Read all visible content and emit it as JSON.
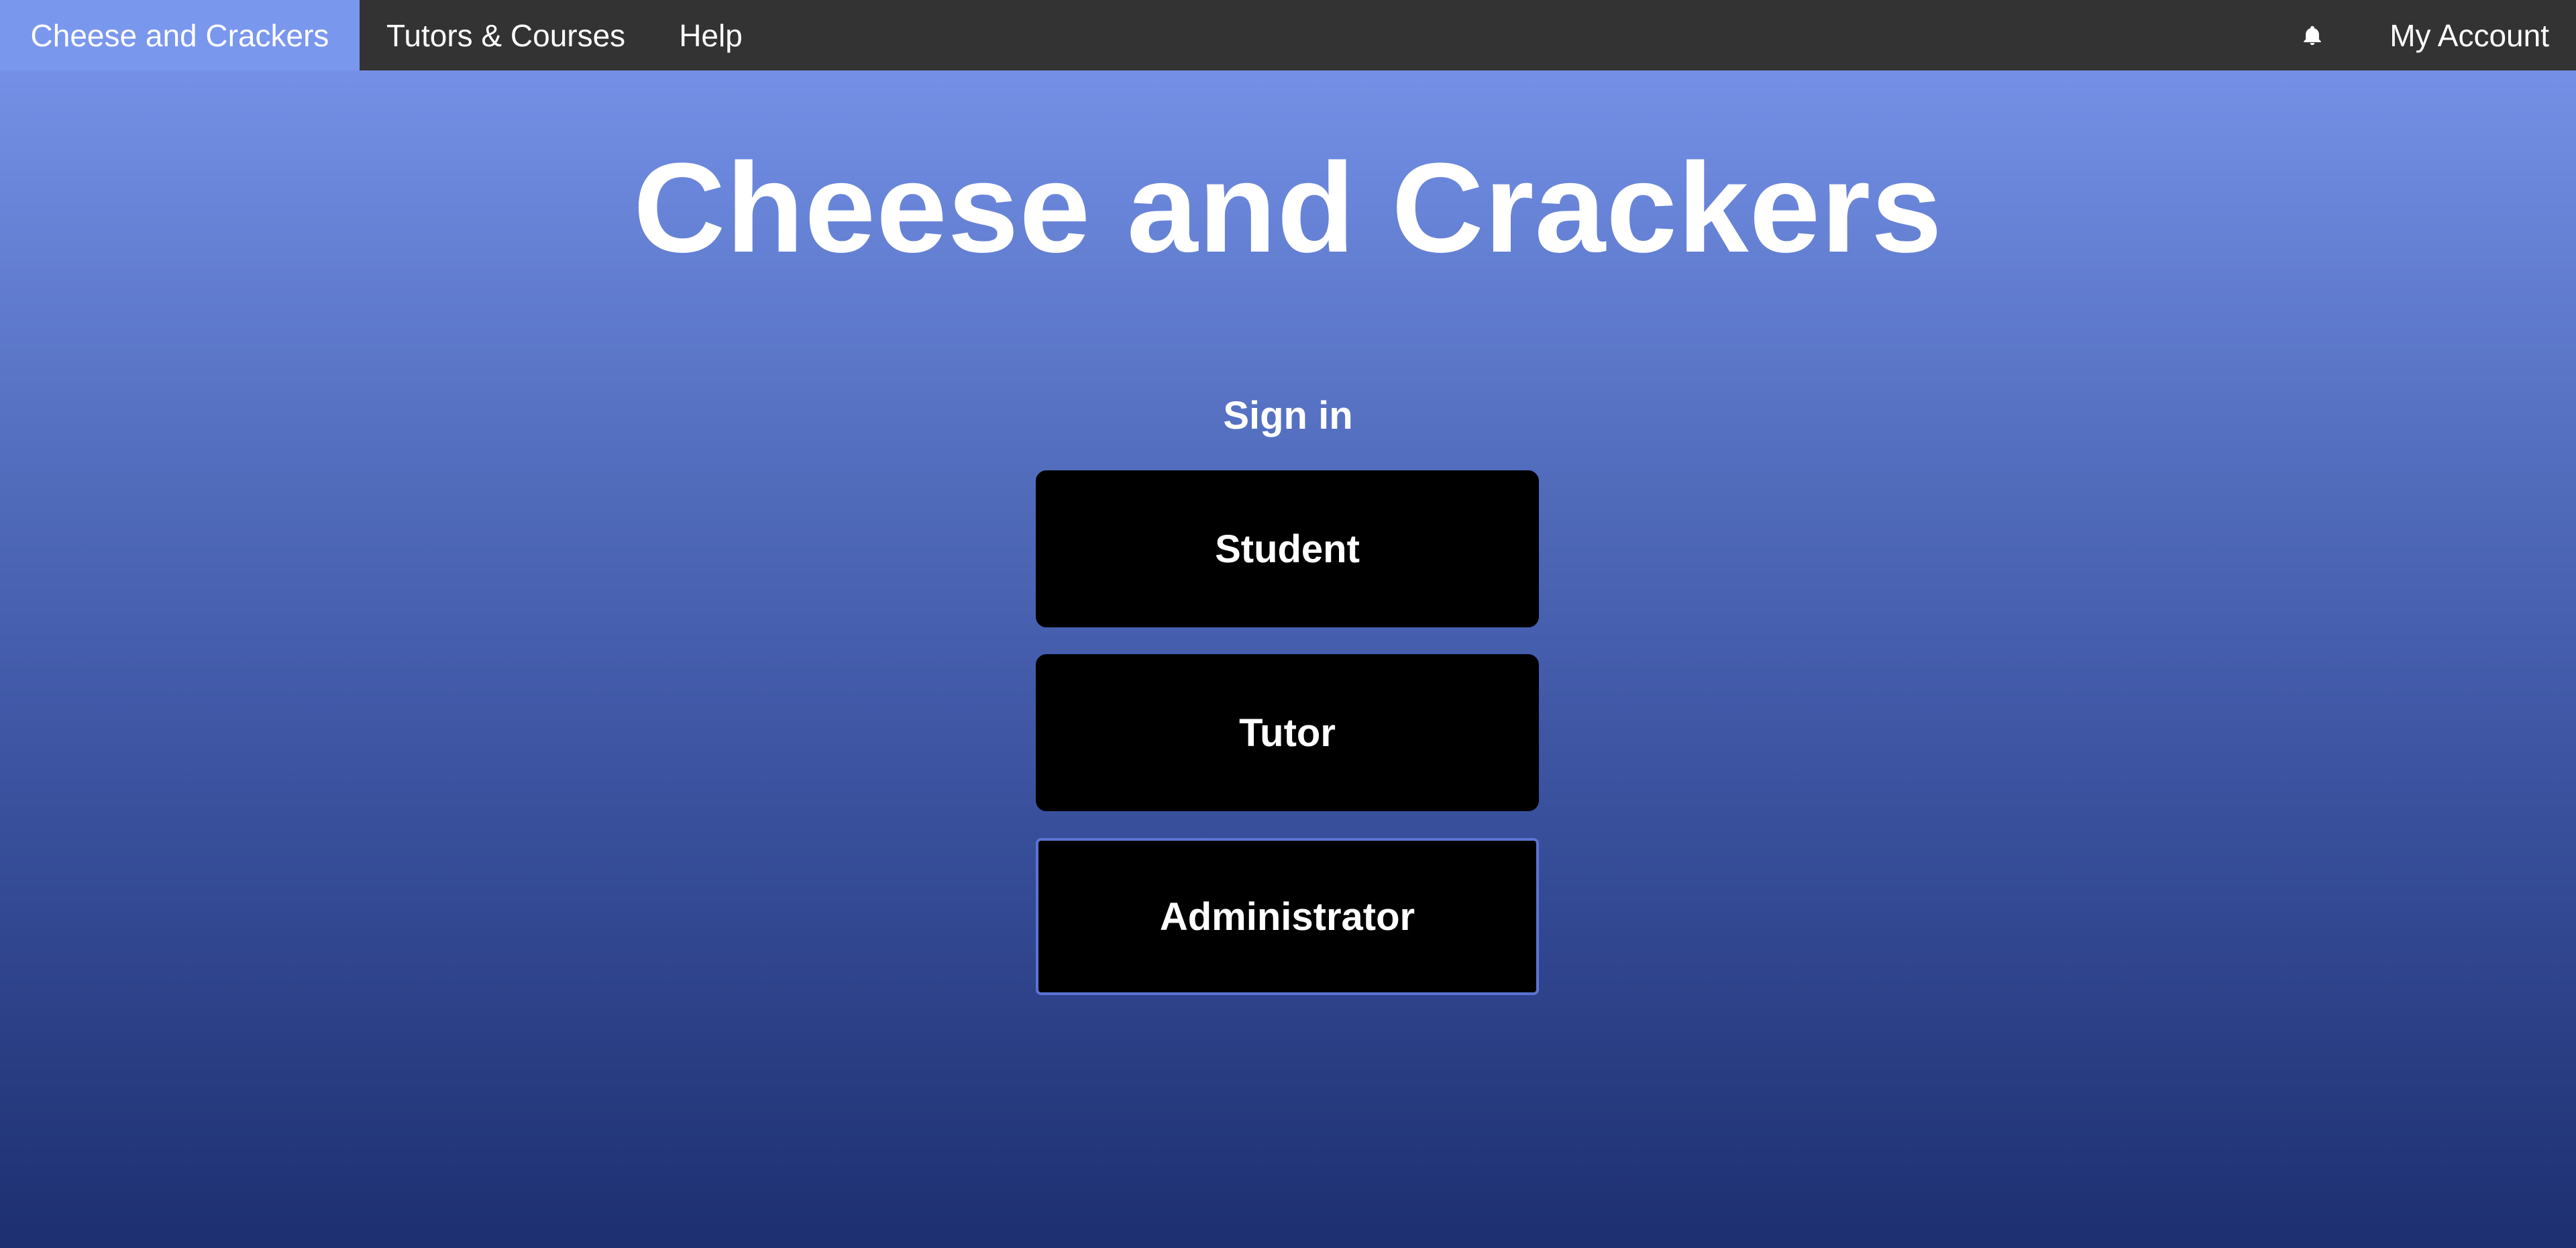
{
  "navbar": {
    "brand": "Cheese and Crackers",
    "links": [
      "Tutors & Courses",
      "Help"
    ],
    "notification_icon": "bell-icon",
    "account_label": "My Account"
  },
  "hero": {
    "title": "Cheese and Crackers"
  },
  "signin": {
    "label": "Sign in",
    "buttons": [
      "Student",
      "Tutor",
      "Administrator"
    ]
  },
  "colors": {
    "navbar_bg": "#333333",
    "brand_bg": "#7a97ee",
    "gradient_top": "#7a97ee",
    "gradient_bottom": "#1d2f70",
    "button_bg": "#000000",
    "focus_border": "#5b74d4",
    "text": "#ffffff"
  }
}
